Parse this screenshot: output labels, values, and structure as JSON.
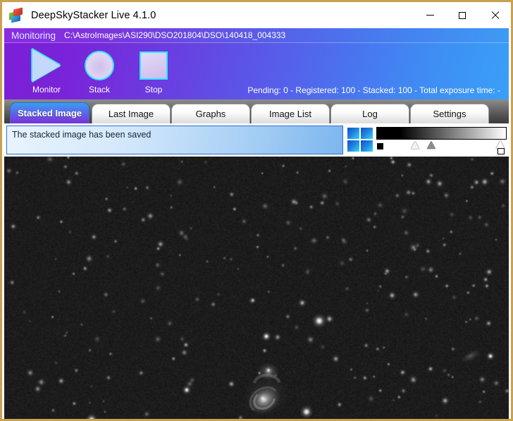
{
  "window": {
    "title": "DeepSkyStacker Live 4.1.0",
    "icon": "app-logo-icon",
    "border_color": "#c8a252",
    "controls": {
      "minimize": "minimize-icon",
      "maximize": "maximize-icon",
      "close": "close-icon"
    }
  },
  "monitor": {
    "label": "Monitoring",
    "path": "C:\\AstroImages\\ASI290\\DSO201804\\DSO\\140418_004333",
    "status": "Pending: 0 - Registered: 100 - Stacked: 100 - Total exposure time: -",
    "counts": {
      "pending": 0,
      "registered": 100,
      "stacked": 100,
      "total_exposure_time": "-"
    },
    "buttons": [
      {
        "label": "Monitor",
        "icon": "play-triangle-icon"
      },
      {
        "label": "Stack",
        "icon": "circle-icon"
      },
      {
        "label": "Stop",
        "icon": "square-icon"
      }
    ],
    "accent_color": "#2ee6ff",
    "gradient_start": "#7b1fd6",
    "gradient_end": "#3aa0f7"
  },
  "tabs": {
    "active_index": 0,
    "items": [
      {
        "label": "Stacked Image"
      },
      {
        "label": "Last Image"
      },
      {
        "label": "Graphs"
      },
      {
        "label": "Image List"
      },
      {
        "label": "Log"
      },
      {
        "label": "Settings"
      }
    ]
  },
  "message": {
    "text": "The stacked image has been saved"
  },
  "toolbar": {
    "grid_icon": "four-squares-grid-icon",
    "levels": {
      "black_point_icon": "black-square-icon",
      "shadow_marker_icon": "shadow-triangle-icon",
      "midtone_marker_icon": "midtone-triangle-icon",
      "white_point_icon": "white-triangle-icon"
    }
  },
  "image_view": {
    "name": "stacked-astro-image",
    "description": "Stacked deep-sky image showing an interacting galaxy pair and star field",
    "background_color": "#1c1c1c"
  }
}
